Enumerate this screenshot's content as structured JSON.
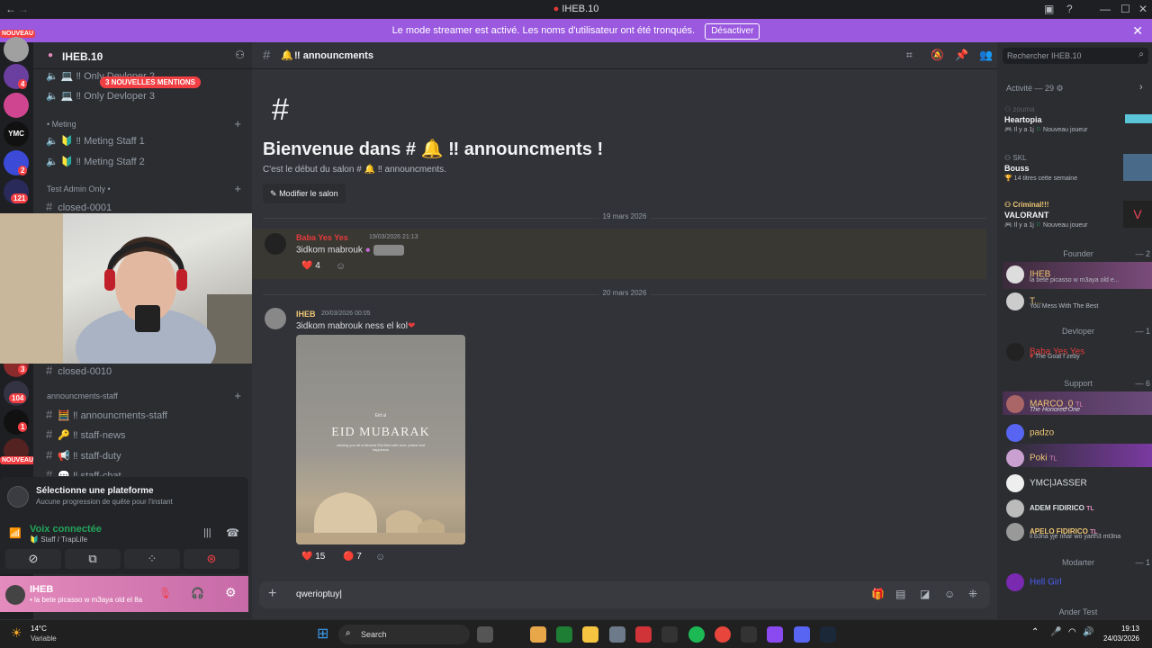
{
  "window": {
    "title": "IHEB.10"
  },
  "banner": {
    "text": "Le mode streamer est activé. Les noms d'utilisateur ont été tronqués.",
    "button": "Désactiver"
  },
  "rail": {
    "top_badge": "NOUVEAU",
    "badges": [
      "4",
      "2",
      "121",
      "3",
      "104",
      "1"
    ],
    "bottom_badge": "NOUVEAU"
  },
  "sidebar": {
    "server_name": "IHEB.10",
    "mentions_pill": "3 NOUVELLES MENTIONS",
    "channels_top": [
      {
        "label": "Only Devloper 2",
        "emoji": "💻"
      },
      {
        "label": "Only Devloper 3",
        "emoji": "💻"
      }
    ],
    "category_meting": "• Meting",
    "meting_channels": [
      {
        "label": "Meting Staff 1",
        "emoji": "🔰"
      },
      {
        "label": "Meting Staff 2",
        "emoji": "🔰"
      }
    ],
    "category_test": "Test Admin Only •",
    "test_channels": [
      "closed-0001",
      "closed-0010"
    ],
    "category_staff": "announcments-staff",
    "staff_channels": [
      {
        "label": "announcments-staff",
        "emoji": "🧮"
      },
      {
        "label": "staff-news",
        "emoji": "🔑"
      },
      {
        "label": "staff-duty",
        "emoji": "📢"
      },
      {
        "label": "staff-chat",
        "emoji": "💬"
      }
    ]
  },
  "quest": {
    "title": "Sélectionne une plateforme",
    "subtitle": "Aucune progression de quête pour l'instant"
  },
  "voice": {
    "status": "Voix connectée",
    "channel": "Staff / TrapLife"
  },
  "user": {
    "name": "IHEB",
    "status": "la bete picasso w m3aya old el 8a"
  },
  "chat": {
    "channel_name": "announcments",
    "welcome_title": "Bienvenue dans # 🔔 ‼ announcments !",
    "welcome_sub": "C'est le début du salon # 🔔 ‼ announcments.",
    "edit_button": "Modifier le salon",
    "date1": "19 mars 2026",
    "msg1": {
      "author": "Baba Yes Yes",
      "time": "19/03/2026 21:13",
      "text": "3idkom mabrouk",
      "reactions": [
        {
          "emoji": "❤️",
          "count": "4"
        }
      ]
    },
    "date2": "20 mars 2026",
    "msg2": {
      "author": "IHEB",
      "time": "20/03/2026 00:05",
      "text": "3idkom mabrouk ness el kol",
      "image_small": "Eid ul",
      "image_title": "EID MUBARAK",
      "image_caption": "wishing you all a blessed Eid filled with love, peace and happiness",
      "reactions": [
        {
          "emoji": "❤️",
          "count": "15"
        },
        {
          "emoji": "🔴",
          "count": "7"
        }
      ]
    },
    "input_value": "qwerioptuy|"
  },
  "search": {
    "placeholder": "Rechercher IHEB.10"
  },
  "activity": {
    "header": "Activité — 29",
    "items": [
      {
        "user": "zouma",
        "game": "Heartopia",
        "meta": "Il y a 1j",
        "tag": "Nouveau joueur"
      },
      {
        "user": "SKL",
        "game": "Bouss",
        "meta": "14 titres cette semaine",
        "tag": ""
      },
      {
        "user": "Criminal!!!",
        "game": "VALORANT",
        "meta": "Il y a 1j",
        "tag": "Nouveau joueur"
      }
    ]
  },
  "members": {
    "roles": [
      {
        "name": "Founder",
        "count": "— 2"
      },
      {
        "name": "Devloper",
        "count": "— 1"
      },
      {
        "name": "Support",
        "count": "— 6"
      },
      {
        "name": "Modarter",
        "count": "— 1"
      },
      {
        "name": "Ander Test",
        "count": ""
      }
    ],
    "founders": [
      {
        "name": "IHEB",
        "status": "la bete picasso w m3aya old e...",
        "color": "#f0c674"
      },
      {
        "name": "T...",
        "status": "You Mess With The Best",
        "color": "#f0c674"
      }
    ],
    "devlopers": [
      {
        "name": "Baba Yes Yes",
        "status": "The Goat f zeby",
        "color": "#e33b3b"
      }
    ],
    "support": [
      {
        "name": "MARCO_0",
        "status": "The Honored One",
        "color": "#f0c674"
      },
      {
        "name": "padzo",
        "status": "",
        "color": "#f0c674"
      },
      {
        "name": "Poki",
        "status": "",
        "color": "#f0c674"
      },
      {
        "name": "YMC|JASSER",
        "status": "",
        "color": "#dbdee1"
      },
      {
        "name": "ADEM FIDIRICO",
        "status": "",
        "color": "#dbdee1"
      },
      {
        "name": "APELO FIDIRICO",
        "status": "il b3na yje nhar wo yarth3 mt3na",
        "color": "#f0c674"
      }
    ],
    "modarter": [
      {
        "name": "Hell Girl",
        "status": "",
        "color": "#4a5cf0"
      }
    ],
    "tl_tag": "TL"
  },
  "taskbar": {
    "weather_temp": "14°C",
    "weather_desc": "Variable",
    "search": "Search",
    "time": "19:13",
    "date": "24/03/2026"
  }
}
